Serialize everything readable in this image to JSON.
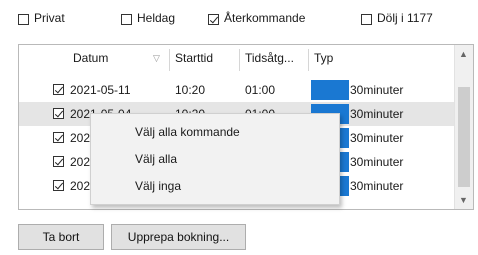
{
  "options": {
    "privat": {
      "label": "Privat",
      "checked": false
    },
    "heldag": {
      "label": "Heldag",
      "checked": false
    },
    "aterkommande": {
      "label": "Återkommande",
      "checked": true
    },
    "dolj": {
      "label": "Dölj i 1177",
      "checked": false
    }
  },
  "table": {
    "columns": [
      "Datum",
      "Starttid",
      "Tidsåtg...",
      "Typ"
    ],
    "sort_icon": "filter-triangle-icon",
    "rows": [
      {
        "checked": true,
        "datum": "2021-05-11",
        "starttid": "10:20",
        "tidsatg": "01:00",
        "typ_color": "#1a78d2",
        "typ": "30minuter",
        "selected": false
      },
      {
        "checked": true,
        "datum": "2021-05-04",
        "starttid": "10:20",
        "tidsatg": "01:00",
        "typ_color": "#1a78d2",
        "typ": "30minuter",
        "selected": true
      },
      {
        "checked": true,
        "datum": "202",
        "starttid": "",
        "tidsatg": "",
        "typ_color": "#1a78d2",
        "typ": "30minuter",
        "selected": false
      },
      {
        "checked": true,
        "datum": "202",
        "starttid": "",
        "tidsatg": "",
        "typ_color": "#1a78d2",
        "typ": "30minuter",
        "selected": false
      },
      {
        "checked": true,
        "datum": "202",
        "starttid": "",
        "tidsatg": "",
        "typ_color": "#1a78d2",
        "typ": "30minuter",
        "selected": false
      }
    ]
  },
  "context_menu": {
    "items": [
      "Välj alla kommande",
      "Välj alla",
      "Välj inga"
    ]
  },
  "buttons": {
    "ta_bort": "Ta bort",
    "upprepa": "Upprepa bokning..."
  }
}
